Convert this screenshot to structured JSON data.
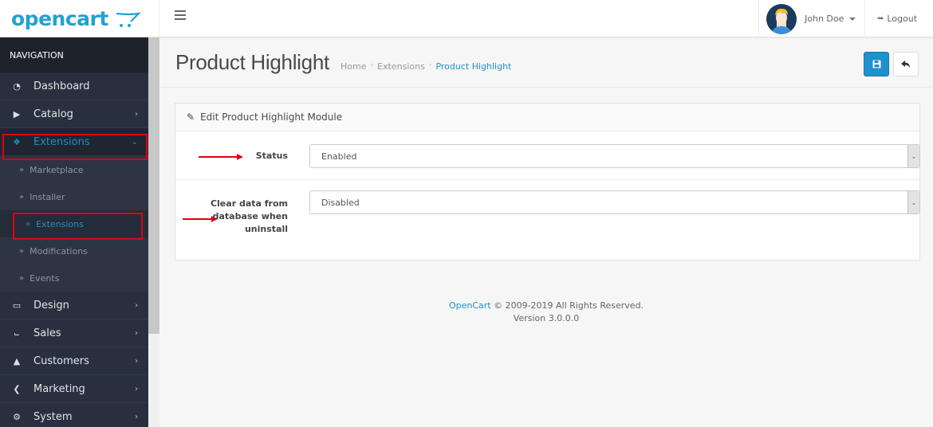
{
  "header": {
    "logo_text": "opencart",
    "user_name": "John Doe",
    "logout_label": "Logout",
    "logout_icon": "sign-out-icon",
    "menu_icon": "hamburger-icon"
  },
  "sidebar": {
    "heading": "NAVIGATION",
    "items": [
      {
        "label": "Dashboard",
        "icon": "dashboard-icon"
      },
      {
        "label": "Catalog",
        "icon": "tags-icon"
      },
      {
        "label": "Extensions",
        "icon": "puzzle-icon",
        "expanded": true
      },
      {
        "label": "Design",
        "icon": "monitor-icon"
      },
      {
        "label": "Sales",
        "icon": "cart-icon"
      },
      {
        "label": "Customers",
        "icon": "user-icon"
      },
      {
        "label": "Marketing",
        "icon": "share-icon"
      },
      {
        "label": "System",
        "icon": "gear-icon"
      }
    ],
    "extensions_sub": [
      {
        "label": "Marketplace"
      },
      {
        "label": "Installer"
      },
      {
        "label": "Extensions",
        "active": true
      },
      {
        "label": "Modifications"
      },
      {
        "label": "Events"
      }
    ]
  },
  "page": {
    "title": "Product Highlight",
    "breadcrumb": [
      "Home",
      "Extensions",
      "Product Highlight"
    ],
    "save_icon": "floppy-disk-icon",
    "back_icon": "reply-icon"
  },
  "panel": {
    "heading": "Edit Product Highlight Module",
    "fields": [
      {
        "label": "Status",
        "value": "Enabled"
      },
      {
        "label": "Clear data from database when uninstall",
        "value": "Disabled"
      }
    ]
  },
  "footer": {
    "brand_link": "OpenCart",
    "copyright": " © 2009-2019 All Rights Reserved.",
    "version": "Version 3.0.0.0"
  },
  "colors": {
    "accent": "#1e91cf",
    "sidebar_bg": "#2a3240",
    "highlight_red": "#e3000f"
  }
}
